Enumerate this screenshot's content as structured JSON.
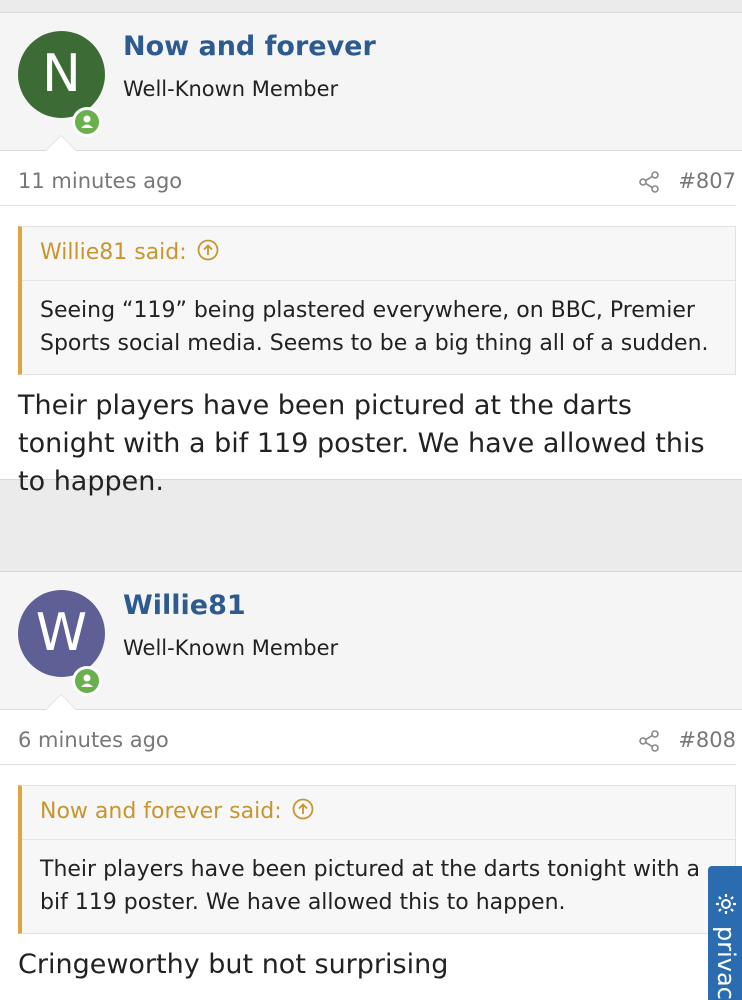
{
  "posts": [
    {
      "username": "Now and forever",
      "user_title": "Well-Known Member",
      "avatar_letter": "N",
      "avatar_color": "#3d6b35",
      "time": "11 minutes ago",
      "post_number": "#807",
      "quote": {
        "author": "Willie81 said:",
        "text": "Seeing “119” being plastered everywhere, on BBC, Premier Sports social media. Seems to be a big thing all of a sudden."
      },
      "body": "Their players have been pictured at the darts tonight with a bif 119 poster. We have allowed this to happen."
    },
    {
      "username": "Willie81",
      "user_title": "Well-Known Member",
      "avatar_letter": "W",
      "avatar_color": "#5e5f95",
      "time": "6 minutes ago",
      "post_number": "#808",
      "quote": {
        "author": "Now and forever said:",
        "text": "Their players have been pictured at the darts tonight with a bif 119 poster. We have allowed this to happen."
      },
      "body": "Cringeworthy but not surprising"
    }
  ],
  "privacy_tab": {
    "label": "privac"
  },
  "colors": {
    "online": "#6ab04c",
    "quote_border": "#e0a441",
    "username": "#2d5b8f",
    "privacy_tab": "#2b6cb0"
  }
}
